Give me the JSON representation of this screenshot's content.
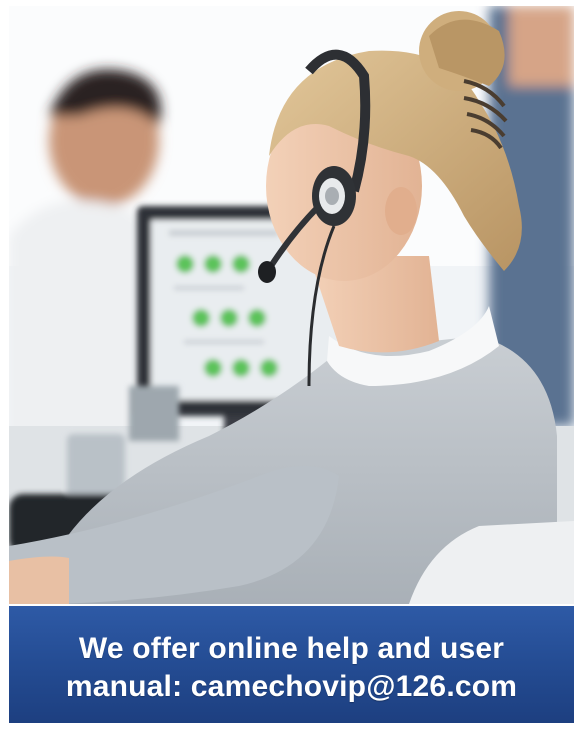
{
  "photo": {
    "description_icon": "call-center-agent-photo"
  },
  "banner": {
    "line1": "We offer online help and user",
    "line2": "manual: camechovip@126.com"
  },
  "colors": {
    "banner_background": "#244c93",
    "banner_text": "#ffffff",
    "screen_dots": "#5cc35a"
  }
}
